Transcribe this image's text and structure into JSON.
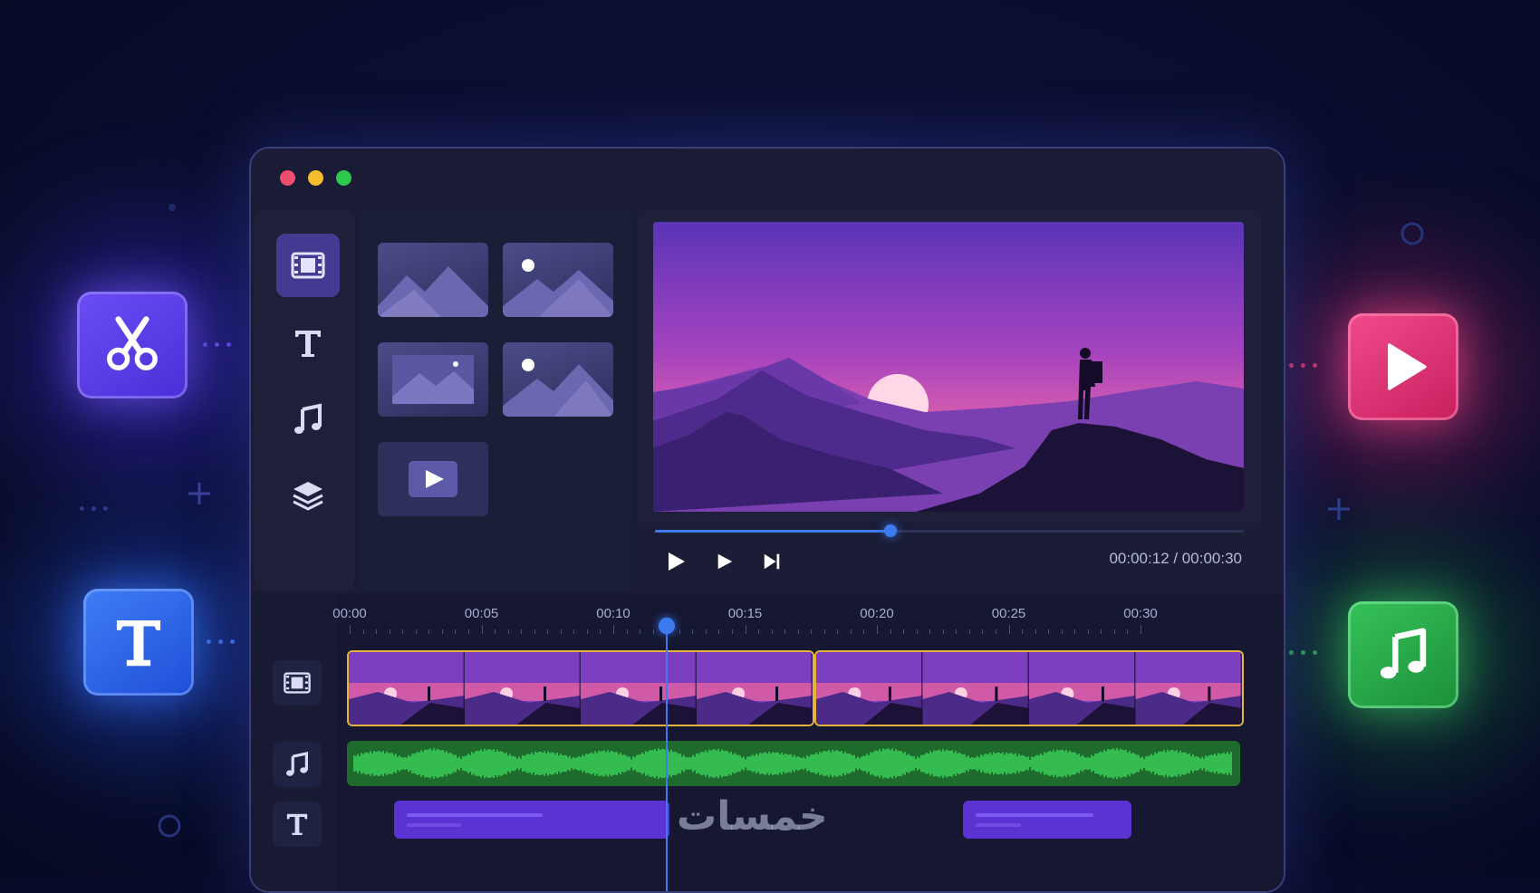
{
  "colors": {
    "accent": "#3d7bf0",
    "clip_border": "#e6b43a",
    "audio_wave": "#39d15a",
    "text_clip": "#5a34d2"
  },
  "floating_tools": [
    {
      "icon": "scissors-icon",
      "color": "#6b4df5"
    },
    {
      "icon": "text-icon",
      "color": "#3f7df6"
    },
    {
      "icon": "play-icon",
      "color": "#f04b8c"
    },
    {
      "icon": "music-note-icon",
      "color": "#36c25a"
    }
  ],
  "window": {
    "traffic_lights": [
      "#ef4d6c",
      "#f4be2f",
      "#2fc84f"
    ]
  },
  "sidebar": {
    "items": [
      {
        "icon": "film-icon",
        "active": true
      },
      {
        "icon": "text-icon",
        "active": false
      },
      {
        "icon": "music-note-icon",
        "active": false
      },
      {
        "icon": "layers-icon",
        "active": false
      }
    ]
  },
  "media_library": {
    "items": [
      "image-thumbnail",
      "image-thumbnail",
      "image-thumbnail",
      "image-thumbnail",
      "video-thumbnail"
    ]
  },
  "player": {
    "progress": 0.4,
    "timecode": "00:00:12 / 00:00:30"
  },
  "timeline": {
    "ticks": [
      "00:00",
      "00:05",
      "00:10",
      "00:15",
      "00:20",
      "00:25",
      "00:30"
    ],
    "playhead": "00:00:12",
    "tracks": [
      {
        "icon": "film-icon"
      },
      {
        "icon": "music-note-icon"
      },
      {
        "icon": "text-icon"
      }
    ]
  },
  "watermark": "خمسات"
}
